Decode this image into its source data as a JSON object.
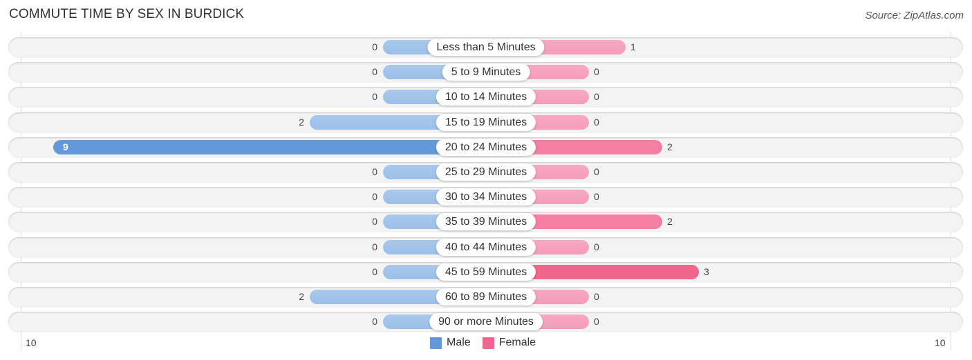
{
  "header": {
    "title": "COMMUTE TIME BY SEX IN BURDICK",
    "source": "Source: ZipAtlas.com"
  },
  "colors": {
    "male": "#6399da",
    "male_light": "#a9c8ec",
    "female": "#f0668f",
    "female_light": "#f8a8c2"
  },
  "chart_data": {
    "type": "bar",
    "orientation": "horizontal-diverging",
    "title": "COMMUTE TIME BY SEX IN BURDICK",
    "categories": [
      "Less than 5 Minutes",
      "5 to 9 Minutes",
      "10 to 14 Minutes",
      "15 to 19 Minutes",
      "20 to 24 Minutes",
      "25 to 29 Minutes",
      "30 to 34 Minutes",
      "35 to 39 Minutes",
      "40 to 44 Minutes",
      "45 to 59 Minutes",
      "60 to 89 Minutes",
      "90 or more Minutes"
    ],
    "series": [
      {
        "name": "Male",
        "values": [
          0,
          0,
          0,
          2,
          9,
          0,
          0,
          0,
          0,
          0,
          2,
          0
        ]
      },
      {
        "name": "Female",
        "values": [
          1,
          0,
          0,
          0,
          2,
          0,
          0,
          2,
          0,
          3,
          0,
          0
        ]
      }
    ],
    "xlim": [
      -10,
      10
    ],
    "axis_tick_labels": {
      "left": "10",
      "right": "10"
    },
    "legend": {
      "position": "bottom-center",
      "entries": [
        "Male",
        "Female"
      ]
    },
    "grid": false
  }
}
